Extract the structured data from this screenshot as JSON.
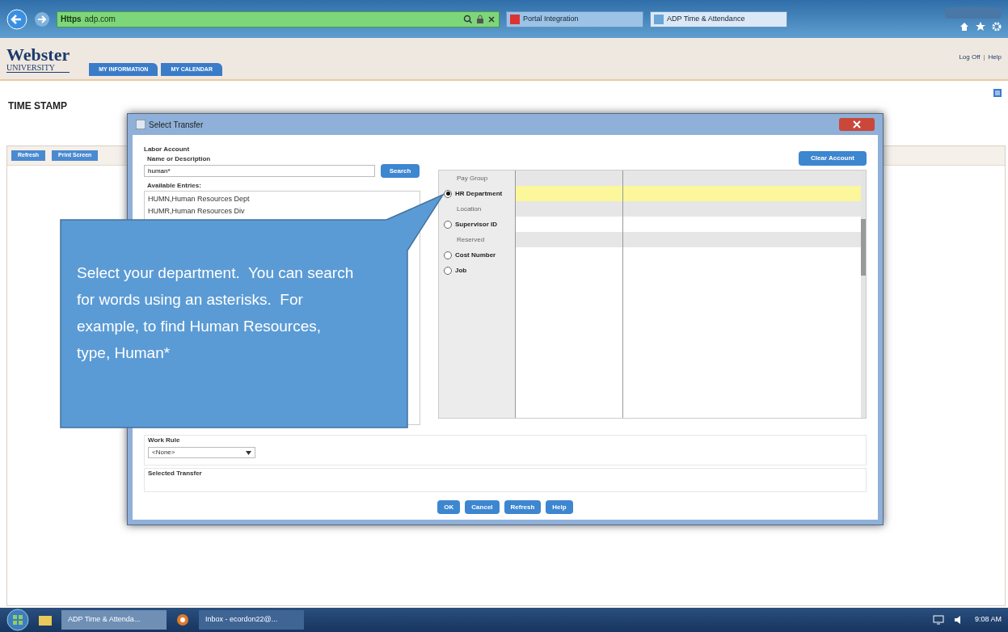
{
  "browser": {
    "address_scheme": "Https",
    "address_host": "adp.com",
    "tabs": [
      {
        "label": "Portal Integration",
        "selected": false
      },
      {
        "label": "ADP Time & Attendance",
        "selected": true
      }
    ]
  },
  "header": {
    "logo_top": "Webster",
    "logo_bottom": "UNIVERSITY",
    "nav": [
      "MY INFORMATION",
      "MY CALENDAR"
    ],
    "links": [
      "Log Off",
      "Help"
    ],
    "links_separator": "|"
  },
  "page": {
    "title": "TIME STAMP",
    "toolbar": [
      "Refresh",
      "Print Screen"
    ]
  },
  "dialog": {
    "title": "Select Transfer",
    "section": "Labor Account",
    "name_label": "Name or Description",
    "name_value": "human*",
    "search_button": "Search",
    "entries_label": "Available Entries:",
    "entries": [
      "HUMN,Human Resources Dept",
      "HUMR,Human Resources Div"
    ],
    "clear_button": "Clear Account",
    "levels": [
      {
        "label": "Pay Group",
        "kind": "header"
      },
      {
        "label": "HR Department",
        "kind": "radio",
        "selected": true
      },
      {
        "label": "Location",
        "kind": "header"
      },
      {
        "label": "Supervisor ID",
        "kind": "radio",
        "selected": false
      },
      {
        "label": "Reserved",
        "kind": "header"
      },
      {
        "label": "Cost Number",
        "kind": "radio",
        "selected": false
      },
      {
        "label": "Job",
        "kind": "radio",
        "selected": false
      }
    ],
    "work_rule_label": "Work Rule",
    "work_rule_value": "<None>",
    "selected_transfer_label": "Selected Transfer",
    "buttons": [
      "OK",
      "Cancel",
      "Refresh",
      "Help"
    ]
  },
  "callout": "Select your department.  You can search for words using an asterisks.  For example, to find Human Resources, type, Human*",
  "taskbar": {
    "items": [
      "ADP Time & Attenda...",
      "Inbox - ecordon22@..."
    ],
    "clock": "9:08 AM"
  }
}
